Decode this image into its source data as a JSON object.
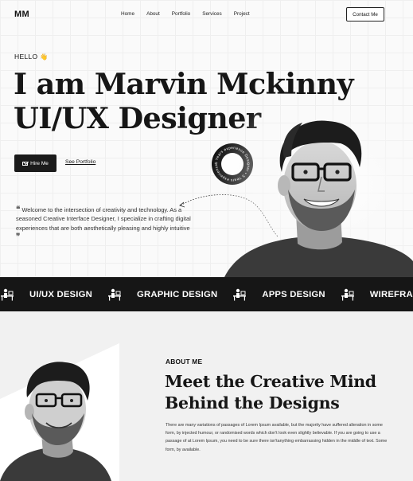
{
  "header": {
    "logo": "MM",
    "nav": [
      "Home",
      "About",
      "Portfolio",
      "Services",
      "Project"
    ],
    "contact_label": "Contact Me"
  },
  "hero": {
    "greeting": "HELLO",
    "greeting_emoji": "👋",
    "headline_line1": "I am Marvin Mckinny",
    "headline_line2": "UI/UX Designer",
    "hire_label": "Hire Me",
    "portfolio_label": "See Portfolio",
    "quote": "Welcome to the intersection of creativity and technology. As a seasoned Creative Interface Designer, I specialize in crafting digital experiences that are both aesthetically pleasing and highly intuitive",
    "badge_text": "5 Years experience Designer • 5 Years experience Designer •"
  },
  "marquee": {
    "items": [
      "UI/UX DESIGN",
      "GRAPHIC DESIGN",
      "APPS DESIGN",
      "WIREFRAME"
    ],
    "icon": "designer-desk-icon"
  },
  "about": {
    "label": "ABOUT ME",
    "title_line1": "Meet the Creative Mind",
    "title_line2": "Behind the Designs",
    "body": "There are many variations of passages of Lorem Ipsum available, but the majority have suffered alteration in some form, by injected humour, or randomised words which don't look even slightly believable. If you are going to use a passage of at Lorem Ipsum, you need to be sure there isn'tanything embarrassing hidden in the middle of text. Some form, by  available."
  },
  "colors": {
    "dark": "#161616",
    "light_bg": "#f1f1f1",
    "white": "#ffffff"
  }
}
